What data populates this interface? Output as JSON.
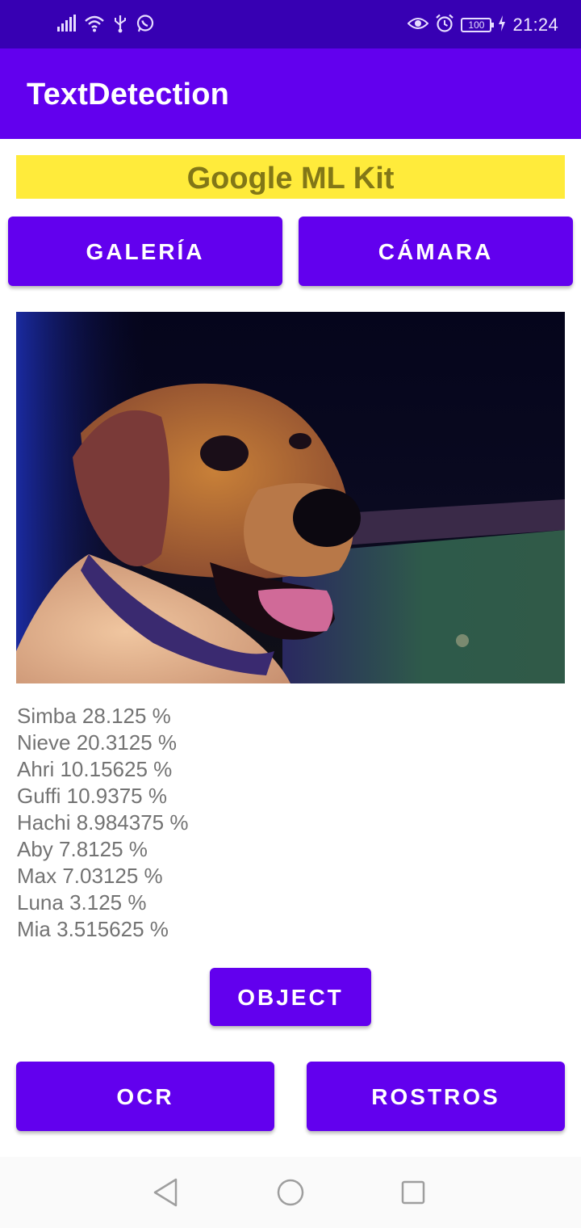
{
  "status_bar": {
    "time": "21:24",
    "battery": "100",
    "left_icons": [
      "signal-icon",
      "wifi-icon",
      "usb-icon",
      "whatsapp-icon"
    ],
    "right_icons": [
      "eye-icon",
      "alarm-icon",
      "battery-icon",
      "charging-icon"
    ]
  },
  "app_bar": {
    "title": "TextDetection"
  },
  "header": {
    "title": "Google ML Kit"
  },
  "buttons": {
    "gallery": "GALERÍA",
    "camera": "CÁMARA",
    "object": "OBJECT",
    "ocr": "OCR",
    "rostros": "ROSTROS"
  },
  "results": [
    "Simba 28.125 %",
    "Nieve 20.3125 %",
    "Ahri 10.15625 %",
    "Guffi 10.9375 %",
    "Hachi 8.984375 %",
    "Aby 7.8125 %",
    "Max 7.03125 %",
    "Luna 3.125 %",
    "Mia 3.515625 %"
  ],
  "nav_bar": {
    "icons": [
      "back-icon",
      "home-icon",
      "recents-icon"
    ]
  },
  "colors": {
    "status_bar": "#3700b3",
    "primary": "#6200ee",
    "banner_bg": "#ffeb3b",
    "banner_text": "#827717",
    "result_text": "#737373"
  }
}
